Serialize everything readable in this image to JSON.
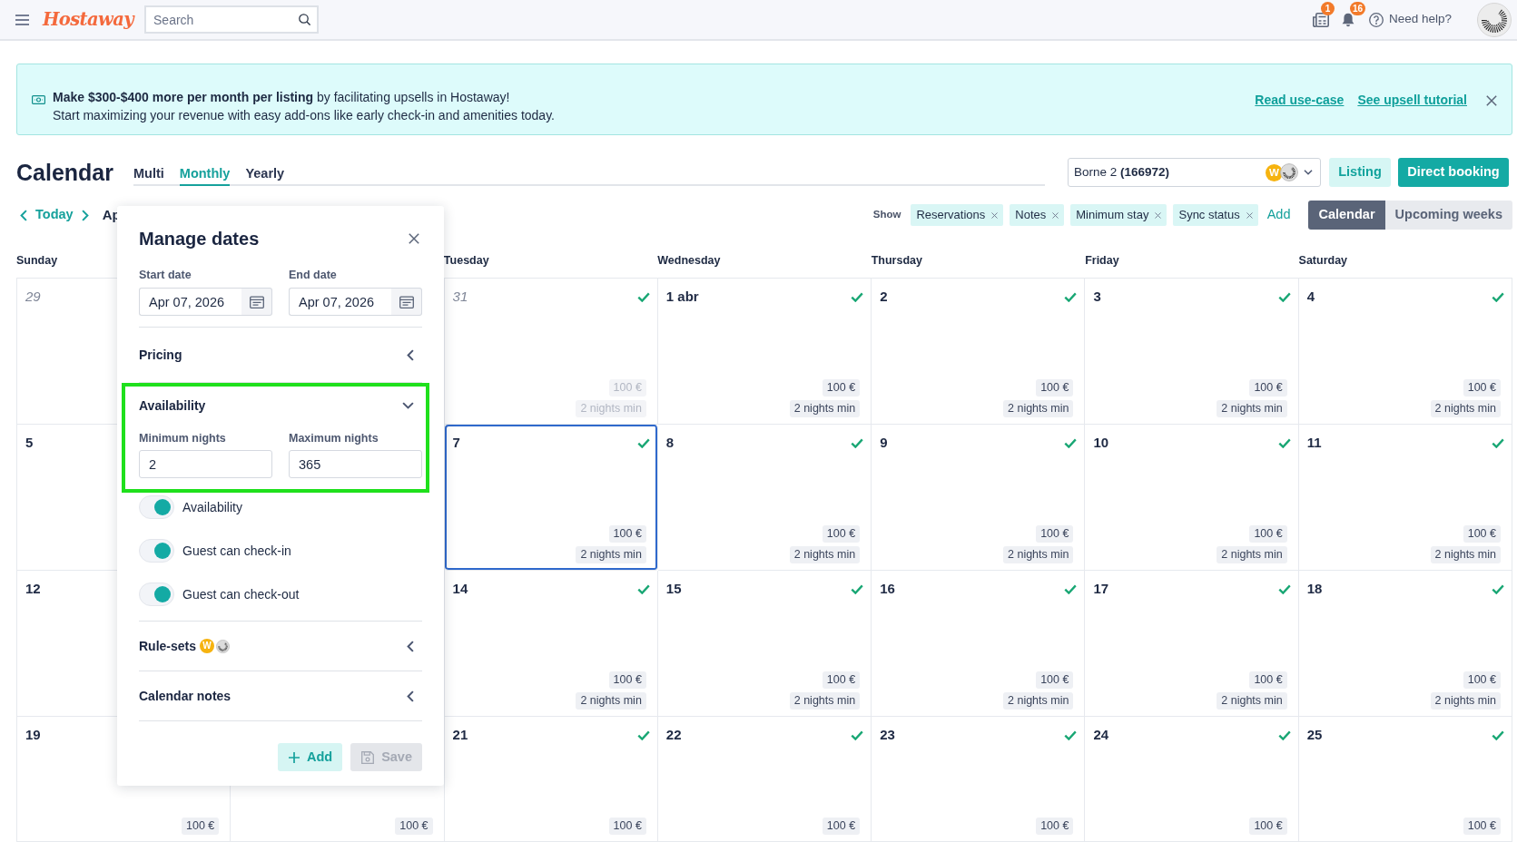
{
  "navbar": {
    "logo": "Hostaway",
    "search": {
      "placeholder": "Search"
    },
    "notifications": [
      {
        "kind": "newspaper",
        "count": "1"
      },
      {
        "kind": "bell",
        "count": "16"
      }
    ],
    "help": "Need help?"
  },
  "banner": {
    "headline": "**Make $300-$400 more per month per listing** by facilitating upsells in Hostaway!",
    "text": "Start maximizing your revenue with easy add-ons like early check-in and amenities today.",
    "links": [
      "Read use-case",
      "See upsell tutorial"
    ]
  },
  "header": {
    "title": "Calendar",
    "tabs": [
      {
        "label": "Multi",
        "selected": false
      },
      {
        "label": "Monthly",
        "selected": true
      },
      {
        "label": "Yearly",
        "selected": false
      }
    ],
    "listing_select": {
      "value": "Borne 2 **(166972)**",
      "avatars": [
        {
          "kind": "initial",
          "label": "W"
        },
        {
          "kind": "logo"
        }
      ]
    },
    "buttons": [
      {
        "label": "Listing",
        "kind": "secondary"
      },
      {
        "label": "Direct booking",
        "kind": "primary"
      }
    ]
  },
  "toolbar": {
    "today": "Today",
    "month": "Ap",
    "show_label": "Show",
    "filters": [
      "Reservations",
      "Notes",
      "Minimum stay",
      "Sync status"
    ],
    "add": "Add",
    "views": [
      {
        "label": "Calendar",
        "selected": true
      },
      {
        "label": "Upcoming weeks",
        "selected": false
      }
    ]
  },
  "calendar": {
    "columns": [
      {
        "weekday": "Sunday",
        "cells": [
          {
            "date": "29",
            "past": true,
            "selected": false
          },
          {
            "date": "5",
            "past": false,
            "selected": false
          },
          {
            "date": "12",
            "past": false,
            "selected": false
          },
          {
            "date": "19",
            "past": false,
            "selected": false,
            "price": "100 €"
          }
        ]
      },
      {
        "cells": [
          {
            "price": "100 €"
          }
        ]
      },
      {
        "weekday": "Tuesday",
        "cells": [
          {
            "date": "31",
            "past": true,
            "selected": false,
            "available": true,
            "price": "100 €",
            "min_stay": "2 nights min"
          },
          {
            "date": "7",
            "past": false,
            "selected": true,
            "available": true,
            "price": "100 €",
            "min_stay": "2 nights min"
          },
          {
            "date": "14",
            "past": false,
            "selected": false,
            "available": true,
            "price": "100 €",
            "min_stay": "2 nights min"
          },
          {
            "date": "21",
            "past": false,
            "selected": false,
            "available": true,
            "price": "100 €"
          }
        ]
      },
      {
        "weekday": "Wednesday",
        "cells": [
          {
            "date": "1 abr",
            "past": false,
            "selected": false,
            "available": true,
            "price": "100 €",
            "min_stay": "2 nights min"
          },
          {
            "date": "8",
            "past": false,
            "selected": false,
            "available": true,
            "price": "100 €",
            "min_stay": "2 nights min"
          },
          {
            "date": "15",
            "past": false,
            "selected": false,
            "available": true,
            "price": "100 €",
            "min_stay": "2 nights min"
          },
          {
            "date": "22",
            "past": false,
            "selected": false,
            "available": true,
            "price": "100 €"
          }
        ]
      },
      {
        "weekday": "Thursday",
        "cells": [
          {
            "date": "2",
            "past": false,
            "selected": false,
            "available": true,
            "price": "100 €",
            "min_stay": "2 nights min"
          },
          {
            "date": "9",
            "past": false,
            "selected": false,
            "available": true,
            "price": "100 €",
            "min_stay": "2 nights min"
          },
          {
            "date": "16",
            "past": false,
            "selected": false,
            "available": true,
            "price": "100 €",
            "min_stay": "2 nights min"
          },
          {
            "date": "23",
            "past": false,
            "selected": false,
            "available": true,
            "price": "100 €"
          }
        ]
      },
      {
        "weekday": "Friday",
        "cells": [
          {
            "date": "3",
            "past": false,
            "selected": false,
            "available": true,
            "price": "100 €",
            "min_stay": "2 nights min"
          },
          {
            "date": "10",
            "past": false,
            "selected": false,
            "available": true,
            "price": "100 €",
            "min_stay": "2 nights min"
          },
          {
            "date": "17",
            "past": false,
            "selected": false,
            "available": true,
            "price": "100 €",
            "min_stay": "2 nights min"
          },
          {
            "date": "24",
            "past": false,
            "selected": false,
            "available": true,
            "price": "100 €"
          }
        ]
      },
      {
        "weekday": "Saturday",
        "cells": [
          {
            "date": "4",
            "past": false,
            "selected": false,
            "available": true,
            "price": "100 €",
            "min_stay": "2 nights min"
          },
          {
            "date": "11",
            "past": false,
            "selected": false,
            "available": true,
            "price": "100 €",
            "min_stay": "2 nights min"
          },
          {
            "date": "18",
            "past": false,
            "selected": false,
            "available": true,
            "price": "100 €",
            "min_stay": "2 nights min"
          },
          {
            "date": "25",
            "past": false,
            "selected": false,
            "available": true,
            "price": "100 €"
          }
        ]
      }
    ]
  },
  "manage_dates": {
    "title": "Manage dates",
    "dates": [
      {
        "label": "Start date",
        "value": "Apr 07, 2026"
      },
      {
        "label": "End date",
        "value": "Apr 07, 2026"
      }
    ],
    "sections": [
      {
        "title": "Pricing",
        "expanded": false,
        "highlighted": false
      },
      {
        "title": "Availability",
        "expanded": true,
        "highlighted": true,
        "fields": [
          {
            "label": "Minimum nights",
            "value": "2"
          },
          {
            "label": "Maximum nights",
            "value": "365"
          }
        ],
        "toggles": [
          {
            "label": "Availability",
            "on": true
          },
          {
            "label": "Guest can check-in",
            "on": true
          },
          {
            "label": "Guest can check-out",
            "on": true
          }
        ]
      },
      {
        "title": "Rule-sets",
        "expanded": false,
        "highlighted": false,
        "avatars": [
          {
            "kind": "initial",
            "label": "W"
          },
          {
            "kind": "logo"
          }
        ]
      },
      {
        "title": "Calendar notes",
        "expanded": false,
        "highlighted": false
      }
    ],
    "buttons": [
      {
        "label": "Add",
        "kind": "add",
        "disabled": false
      },
      {
        "label": "Save",
        "kind": "save",
        "disabled": true
      }
    ]
  }
}
